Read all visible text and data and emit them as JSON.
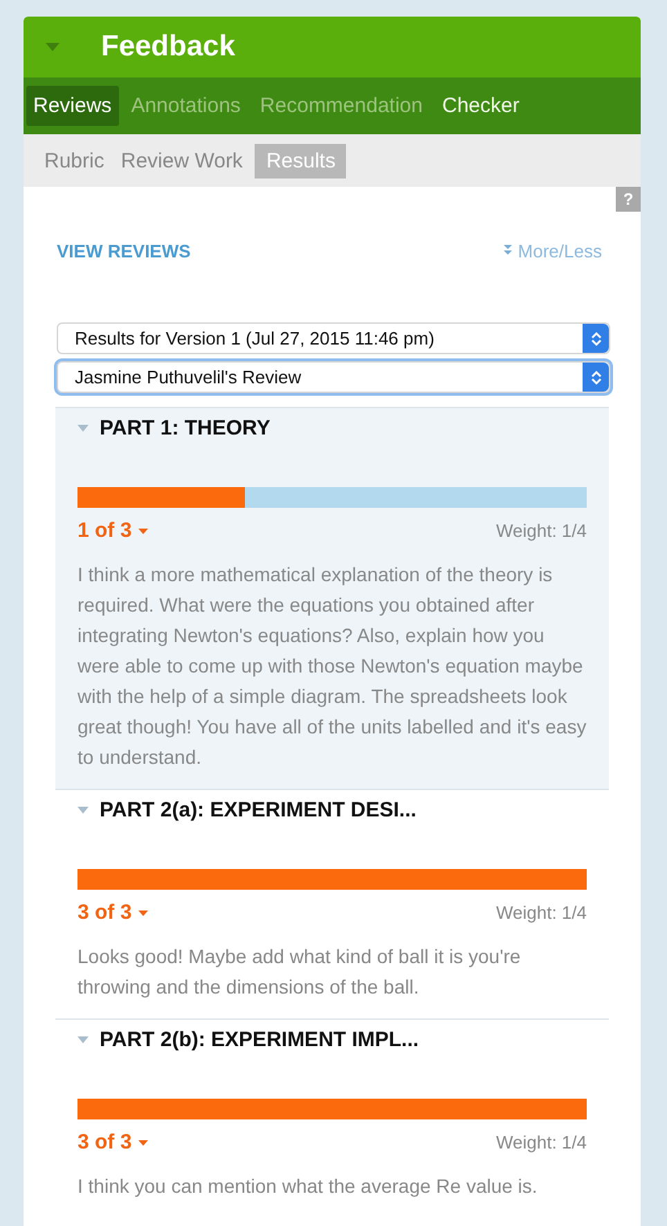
{
  "header": {
    "title": "Feedback"
  },
  "tabs": [
    {
      "label": "Reviews",
      "selected": true
    },
    {
      "label": "Annotations",
      "selected": false
    },
    {
      "label": "Recommendation",
      "selected": false
    },
    {
      "label": "Checker",
      "selected": false
    }
  ],
  "subtabs": [
    {
      "label": "Rubric",
      "selected": false
    },
    {
      "label": "Review Work",
      "selected": false
    },
    {
      "label": "Results",
      "selected": true
    }
  ],
  "help": "?",
  "view_reviews": "VIEW REVIEWS",
  "more_less": "More/Less",
  "version_select": "Results for Version 1 (Jul 27, 2015 11:46 pm)",
  "review_select": "Jasmine Puthuvelil's Review",
  "parts": [
    {
      "title": "PART 1: THEORY",
      "level": 0.33,
      "score": "1 of 3",
      "weight": "Weight: 1/4",
      "comment": "I think a more mathematical explanation of the theory is required. What were the equations you obtained after integrating Newton's equations? Also, explain how you were able to come up with those Newton's equation maybe with the help of a simple diagram. The spreadsheets look great though! You have all of the units labelled and it's easy to understand.",
      "highlighted": true
    },
    {
      "title": "PART 2(a): EXPERIMENT DESI...",
      "level": 1,
      "score": "3 of 3",
      "weight": "Weight: 1/4",
      "comment": "Looks good! Maybe add what kind of ball it is you're throwing and the dimensions of the ball.",
      "highlighted": false
    },
    {
      "title": "PART 2(b): EXPERIMENT IMPL...",
      "level": 1,
      "score": "3 of 3",
      "weight": "Weight: 1/4",
      "comment": "I think you can mention what the average Re value is.",
      "highlighted": false
    }
  ]
}
